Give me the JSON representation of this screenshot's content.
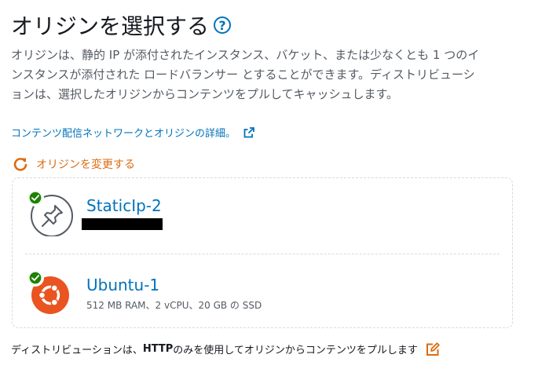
{
  "header": {
    "title": "オリジンを選択する",
    "help_glyph": "?"
  },
  "description": "オリジンは、静的 IP が添付されたインスタンス、バケット、または少なくとも 1 つのインスタンスが添付された ロードバランサー とすることができます。ディストリビューションは、選択したオリジンからコンテンツをプルしてキャッシュします。",
  "details_link": "コンテンツ配信ネットワークとオリジンの詳細。",
  "change_origin_label": "オリジンを変更する",
  "origins": [
    {
      "name": "StaticIp-2",
      "icon": "pin-icon",
      "status": "selected-check"
    },
    {
      "name": "Ubuntu-1",
      "subtitle": "512 MB RAM、2 vCPU、20 GB の SSD",
      "icon": "ubuntu-icon",
      "status": "selected-check"
    }
  ],
  "footer": {
    "text_before": "ディストリビューションは、",
    "protocol": "HTTP",
    "text_after": " のみを使用してオリジンからコンテンツをプルします"
  },
  "colors": {
    "link": "#0073bb",
    "accent_orange": "#dd6b10",
    "success_green": "#1d8102",
    "ubuntu_orange": "#e95420"
  }
}
